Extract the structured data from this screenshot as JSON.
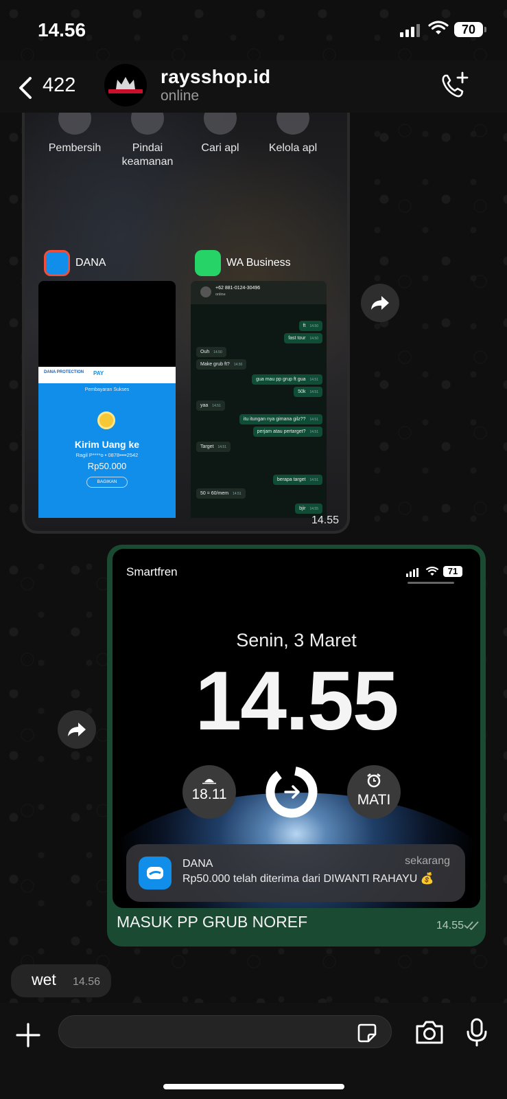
{
  "status_bar": {
    "time": "14.56",
    "battery": "70"
  },
  "header": {
    "back_count": "422",
    "contact_name": "raysshop.id",
    "contact_status": "online"
  },
  "message1": {
    "quick_actions": [
      "Pembersih",
      "Pindai keamanan",
      "Cari apl",
      "Kelola apl"
    ],
    "apps": [
      {
        "name": "DANA"
      },
      {
        "name": "WA Business"
      }
    ],
    "dana": {
      "header_left": "DANA PROTECTION",
      "header_pay": "PAY",
      "subtitle": "Pembayaran Sukses",
      "title": "Kirim Uang ke",
      "recipient": "Ragil P****o • 0878••••2542",
      "amount": "Rp50.000",
      "share": "BAGIKAN"
    },
    "wa": {
      "contact": "+62 881-0124-30496",
      "status": "online",
      "bubbles": [
        {
          "text": "ft",
          "time": "14.50",
          "dir": "out"
        },
        {
          "text": "fast tour",
          "time": "14.50",
          "dir": "out"
        },
        {
          "text": "Ouh",
          "time": "14.50",
          "dir": "in"
        },
        {
          "text": "Make grub ft?",
          "time": "14.50",
          "dir": "in"
        },
        {
          "text": "gua mau pp grup ft gua",
          "time": "14.51",
          "dir": "out"
        },
        {
          "text": "50k",
          "time": "14.51",
          "dir": "out"
        },
        {
          "text": "yaa",
          "time": "14.51",
          "dir": "in"
        },
        {
          "text": "itu itungan nya gimana gilz??",
          "time": "14.51",
          "dir": "out"
        },
        {
          "text": "perjam atau pertarget?",
          "time": "14.51",
          "dir": "out"
        },
        {
          "text": "Target",
          "time": "14.51",
          "dir": "in"
        },
        {
          "text": "berapa target",
          "time": "14.51",
          "dir": "out"
        },
        {
          "text": "50 = 60/mem",
          "time": "14.51",
          "dir": "in"
        },
        {
          "text": "bjir",
          "time": "14.55",
          "dir": "out"
        }
      ]
    },
    "time": "14.55"
  },
  "message2": {
    "phone": {
      "carrier": "Smartfren",
      "battery": "71",
      "date": "Senin, 3 Maret",
      "clock": "14.55",
      "sunset": "18.11",
      "alarm": "MATI"
    },
    "notification": {
      "app": "DANA",
      "when": "sekarang",
      "body": "Rp50.000 telah diterima dari DIWANTI RAHAYU 💰"
    },
    "caption": "MASUK PP GRUB NOREF",
    "time": "14.55"
  },
  "message3": {
    "text": "wet",
    "time": "14.56"
  },
  "colors": {
    "outgoing_bubble": "#1b4a32",
    "incoming_bubble": "#252525",
    "dana_blue": "#118ee9",
    "wa_green": "#25d366"
  }
}
